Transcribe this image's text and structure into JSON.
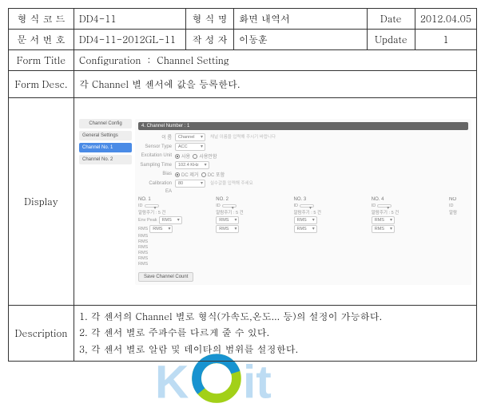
{
  "header": {
    "r1c1": "형 식  코 드",
    "r1c2": "DD4-11",
    "r1c3": "형 식 명",
    "r1c4": "화면 내역서",
    "r1c5": "Date",
    "r1c6": "2012.04.05",
    "r2c1": "문 서  번 호",
    "r2c2": "DD4-11-2012GL-11",
    "r2c3": "작 성 자",
    "r2c4": "이동훈",
    "r2c5": "Update",
    "r2c6": "1"
  },
  "formTitle": {
    "label": "Form Title",
    "value": "Configuration ： Channel Setting"
  },
  "formDesc": {
    "label": "Form Desc.",
    "value": "각 Channel  별 센서에 값을 등록한다."
  },
  "displayLabel": "Display",
  "shot": {
    "sideHeader": "Channel Config",
    "sideItems": [
      "General Settings",
      "Channel No. 1",
      "Channel No. 2"
    ],
    "panelHeader": "4. Channel Number : 1",
    "fields": {
      "name": {
        "k": "이 름",
        "v": "Channel",
        "note": "채널 이름을 입력해 주시기 바랍니다"
      },
      "type": {
        "k": "Sensor Type",
        "v": "ACC"
      },
      "exc": {
        "k": "Excitation Unit",
        "opt1": "사용",
        "opt2": "사용안함"
      },
      "samp": {
        "k": "Sampling Time",
        "v": "102.4 KHz"
      },
      "bias": {
        "k": "Bias",
        "opt1": "DC 제거",
        "opt2": "DC 포함"
      },
      "calib": {
        "k": "Calibration",
        "v": "80",
        "note": "실수값을 입력해 주세요"
      }
    },
    "ea": "EA",
    "gridCols": [
      "NO. 1",
      "NO. 2",
      "NO. 3",
      "NO. 4",
      "NO"
    ],
    "gridIdLabel": "ID",
    "gridInterval": "알람주기 : 5 건",
    "rows": [
      "Env Peak",
      "RMS",
      "RMS",
      "RMS",
      "RMS",
      "RMS",
      "RMS",
      "RMS"
    ],
    "rowDD": "RMS",
    "save": "Save Channel Count"
  },
  "description": {
    "label": "Description",
    "lines": [
      "1. 각 센서의 Channel  별로 형식(가속도,온도... 등)의 설정이 가능하다.",
      "2. 각 센서 별로 주파수를 다르게 줄 수 있다.",
      "3, 각 센서 별로 알람 및 데이타의  범위를 설정한다."
    ]
  }
}
